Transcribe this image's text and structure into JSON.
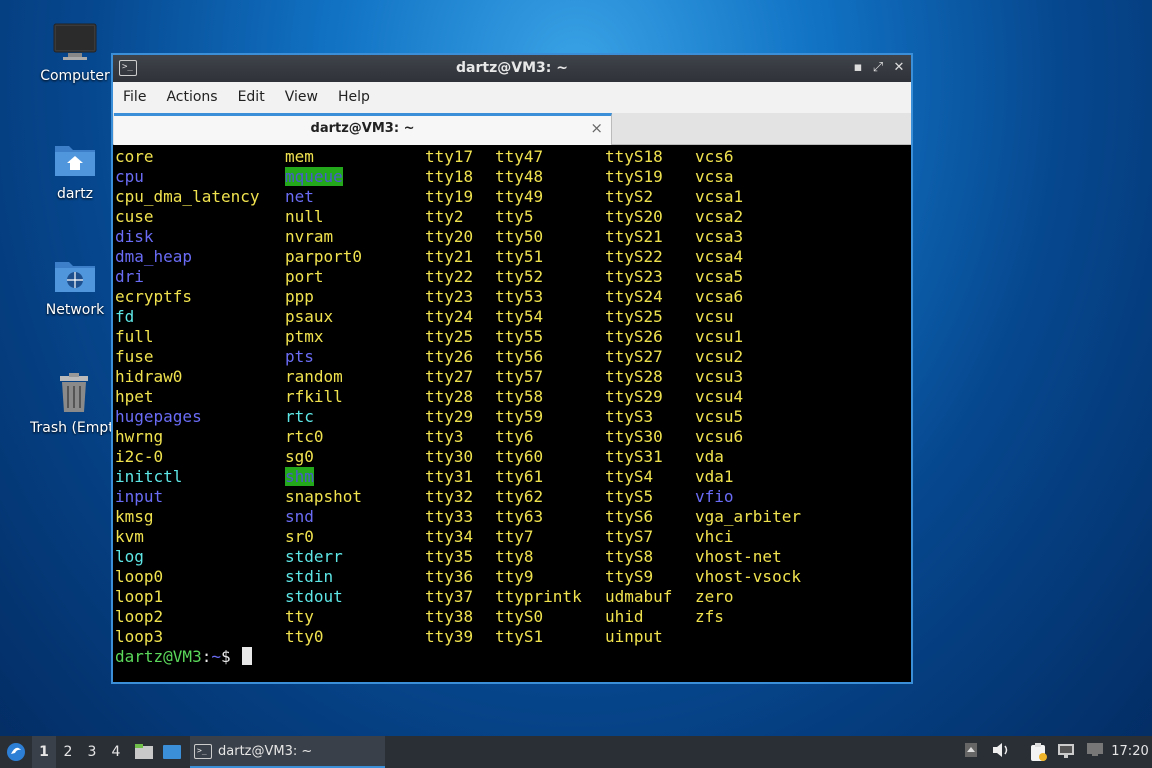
{
  "desktop": {
    "icons": [
      {
        "label": "Computer",
        "icon": "monitor-icon"
      },
      {
        "label": "dartz",
        "icon": "home-folder-icon"
      },
      {
        "label": "Network",
        "icon": "network-folder-icon"
      },
      {
        "label": "Trash (Empty)",
        "icon": "trash-icon"
      }
    ]
  },
  "window": {
    "title": "dartz@VM3: ~",
    "menu": [
      "File",
      "Actions",
      "Edit",
      "View",
      "Help"
    ],
    "tab_label": "dartz@VM3: ~",
    "tab_close": "×"
  },
  "terminal": {
    "columns": [
      [
        {
          "t": "core",
          "c": "yellow"
        },
        {
          "t": "cpu",
          "c": "blue"
        },
        {
          "t": "cpu_dma_latency",
          "c": "yellow"
        },
        {
          "t": "cuse",
          "c": "yellow"
        },
        {
          "t": "disk",
          "c": "blue"
        },
        {
          "t": "dma_heap",
          "c": "blue"
        },
        {
          "t": "dri",
          "c": "blue"
        },
        {
          "t": "ecryptfs",
          "c": "yellow"
        },
        {
          "t": "fd",
          "c": "cyan"
        },
        {
          "t": "full",
          "c": "yellow"
        },
        {
          "t": "fuse",
          "c": "yellow"
        },
        {
          "t": "hidraw0",
          "c": "yellow"
        },
        {
          "t": "hpet",
          "c": "yellow"
        },
        {
          "t": "hugepages",
          "c": "blue"
        },
        {
          "t": "hwrng",
          "c": "yellow"
        },
        {
          "t": "i2c-0",
          "c": "yellow"
        },
        {
          "t": "initctl",
          "c": "cyan"
        },
        {
          "t": "input",
          "c": "blue"
        },
        {
          "t": "kmsg",
          "c": "yellow"
        },
        {
          "t": "kvm",
          "c": "yellow"
        },
        {
          "t": "log",
          "c": "cyan"
        },
        {
          "t": "loop0",
          "c": "yellow"
        },
        {
          "t": "loop1",
          "c": "yellow"
        },
        {
          "t": "loop2",
          "c": "yellow"
        },
        {
          "t": "loop3",
          "c": "yellow"
        }
      ],
      [
        {
          "t": "mem",
          "c": "yellow"
        },
        {
          "t": "mqueue",
          "c": "hl"
        },
        {
          "t": "net",
          "c": "blue"
        },
        {
          "t": "null",
          "c": "yellow"
        },
        {
          "t": "nvram",
          "c": "yellow"
        },
        {
          "t": "parport0",
          "c": "yellow"
        },
        {
          "t": "port",
          "c": "yellow"
        },
        {
          "t": "ppp",
          "c": "yellow"
        },
        {
          "t": "psaux",
          "c": "yellow"
        },
        {
          "t": "ptmx",
          "c": "yellow"
        },
        {
          "t": "pts",
          "c": "blue"
        },
        {
          "t": "random",
          "c": "yellow"
        },
        {
          "t": "rfkill",
          "c": "yellow"
        },
        {
          "t": "rtc",
          "c": "cyan"
        },
        {
          "t": "rtc0",
          "c": "yellow"
        },
        {
          "t": "sg0",
          "c": "yellow"
        },
        {
          "t": "shm",
          "c": "hl"
        },
        {
          "t": "snapshot",
          "c": "yellow"
        },
        {
          "t": "snd",
          "c": "blue"
        },
        {
          "t": "sr0",
          "c": "yellow"
        },
        {
          "t": "stderr",
          "c": "cyan"
        },
        {
          "t": "stdin",
          "c": "cyan"
        },
        {
          "t": "stdout",
          "c": "cyan"
        },
        {
          "t": "tty",
          "c": "yellow"
        },
        {
          "t": "tty0",
          "c": "yellow"
        }
      ],
      [
        {
          "t": "tty17",
          "c": "yellow"
        },
        {
          "t": "tty18",
          "c": "yellow"
        },
        {
          "t": "tty19",
          "c": "yellow"
        },
        {
          "t": "tty2",
          "c": "yellow"
        },
        {
          "t": "tty20",
          "c": "yellow"
        },
        {
          "t": "tty21",
          "c": "yellow"
        },
        {
          "t": "tty22",
          "c": "yellow"
        },
        {
          "t": "tty23",
          "c": "yellow"
        },
        {
          "t": "tty24",
          "c": "yellow"
        },
        {
          "t": "tty25",
          "c": "yellow"
        },
        {
          "t": "tty26",
          "c": "yellow"
        },
        {
          "t": "tty27",
          "c": "yellow"
        },
        {
          "t": "tty28",
          "c": "yellow"
        },
        {
          "t": "tty29",
          "c": "yellow"
        },
        {
          "t": "tty3",
          "c": "yellow"
        },
        {
          "t": "tty30",
          "c": "yellow"
        },
        {
          "t": "tty31",
          "c": "yellow"
        },
        {
          "t": "tty32",
          "c": "yellow"
        },
        {
          "t": "tty33",
          "c": "yellow"
        },
        {
          "t": "tty34",
          "c": "yellow"
        },
        {
          "t": "tty35",
          "c": "yellow"
        },
        {
          "t": "tty36",
          "c": "yellow"
        },
        {
          "t": "tty37",
          "c": "yellow"
        },
        {
          "t": "tty38",
          "c": "yellow"
        },
        {
          "t": "tty39",
          "c": "yellow"
        }
      ],
      [
        {
          "t": "tty47",
          "c": "yellow"
        },
        {
          "t": "tty48",
          "c": "yellow"
        },
        {
          "t": "tty49",
          "c": "yellow"
        },
        {
          "t": "tty5",
          "c": "yellow"
        },
        {
          "t": "tty50",
          "c": "yellow"
        },
        {
          "t": "tty51",
          "c": "yellow"
        },
        {
          "t": "tty52",
          "c": "yellow"
        },
        {
          "t": "tty53",
          "c": "yellow"
        },
        {
          "t": "tty54",
          "c": "yellow"
        },
        {
          "t": "tty55",
          "c": "yellow"
        },
        {
          "t": "tty56",
          "c": "yellow"
        },
        {
          "t": "tty57",
          "c": "yellow"
        },
        {
          "t": "tty58",
          "c": "yellow"
        },
        {
          "t": "tty59",
          "c": "yellow"
        },
        {
          "t": "tty6",
          "c": "yellow"
        },
        {
          "t": "tty60",
          "c": "yellow"
        },
        {
          "t": "tty61",
          "c": "yellow"
        },
        {
          "t": "tty62",
          "c": "yellow"
        },
        {
          "t": "tty63",
          "c": "yellow"
        },
        {
          "t": "tty7",
          "c": "yellow"
        },
        {
          "t": "tty8",
          "c": "yellow"
        },
        {
          "t": "tty9",
          "c": "yellow"
        },
        {
          "t": "ttyprintk",
          "c": "yellow"
        },
        {
          "t": "ttyS0",
          "c": "yellow"
        },
        {
          "t": "ttyS1",
          "c": "yellow"
        }
      ],
      [
        {
          "t": "ttyS18",
          "c": "yellow"
        },
        {
          "t": "ttyS19",
          "c": "yellow"
        },
        {
          "t": "ttyS2",
          "c": "yellow"
        },
        {
          "t": "ttyS20",
          "c": "yellow"
        },
        {
          "t": "ttyS21",
          "c": "yellow"
        },
        {
          "t": "ttyS22",
          "c": "yellow"
        },
        {
          "t": "ttyS23",
          "c": "yellow"
        },
        {
          "t": "ttyS24",
          "c": "yellow"
        },
        {
          "t": "ttyS25",
          "c": "yellow"
        },
        {
          "t": "ttyS26",
          "c": "yellow"
        },
        {
          "t": "ttyS27",
          "c": "yellow"
        },
        {
          "t": "ttyS28",
          "c": "yellow"
        },
        {
          "t": "ttyS29",
          "c": "yellow"
        },
        {
          "t": "ttyS3",
          "c": "yellow"
        },
        {
          "t": "ttyS30",
          "c": "yellow"
        },
        {
          "t": "ttyS31",
          "c": "yellow"
        },
        {
          "t": "ttyS4",
          "c": "yellow"
        },
        {
          "t": "ttyS5",
          "c": "yellow"
        },
        {
          "t": "ttyS6",
          "c": "yellow"
        },
        {
          "t": "ttyS7",
          "c": "yellow"
        },
        {
          "t": "ttyS8",
          "c": "yellow"
        },
        {
          "t": "ttyS9",
          "c": "yellow"
        },
        {
          "t": "udmabuf",
          "c": "yellow"
        },
        {
          "t": "uhid",
          "c": "yellow"
        },
        {
          "t": "uinput",
          "c": "yellow"
        }
      ],
      [
        {
          "t": "vcs6",
          "c": "yellow"
        },
        {
          "t": "vcsa",
          "c": "yellow"
        },
        {
          "t": "vcsa1",
          "c": "yellow"
        },
        {
          "t": "vcsa2",
          "c": "yellow"
        },
        {
          "t": "vcsa3",
          "c": "yellow"
        },
        {
          "t": "vcsa4",
          "c": "yellow"
        },
        {
          "t": "vcsa5",
          "c": "yellow"
        },
        {
          "t": "vcsa6",
          "c": "yellow"
        },
        {
          "t": "vcsu",
          "c": "yellow"
        },
        {
          "t": "vcsu1",
          "c": "yellow"
        },
        {
          "t": "vcsu2",
          "c": "yellow"
        },
        {
          "t": "vcsu3",
          "c": "yellow"
        },
        {
          "t": "vcsu4",
          "c": "yellow"
        },
        {
          "t": "vcsu5",
          "c": "yellow"
        },
        {
          "t": "vcsu6",
          "c": "yellow"
        },
        {
          "t": "vda",
          "c": "yellow"
        },
        {
          "t": "vda1",
          "c": "yellow"
        },
        {
          "t": "vfio",
          "c": "blue"
        },
        {
          "t": "vga_arbiter",
          "c": "yellow"
        },
        {
          "t": "vhci",
          "c": "yellow"
        },
        {
          "t": "vhost-net",
          "c": "yellow"
        },
        {
          "t": "vhost-vsock",
          "c": "yellow"
        },
        {
          "t": "zero",
          "c": "yellow"
        },
        {
          "t": "zfs",
          "c": "yellow"
        }
      ]
    ],
    "prompt": {
      "user": "dartz@VM3",
      "sep": ":",
      "dir": "~",
      "symbol": "$ "
    }
  },
  "taskbar": {
    "workspaces": [
      "1",
      "2",
      "3",
      "4"
    ],
    "active_workspace": "1",
    "task_label": "dartz@VM3: ~",
    "clock": "17:20"
  },
  "colors": {
    "accent": "#3b8fd8",
    "term_yellow": "#f0e24f",
    "term_blue": "#6a6cf6",
    "term_cyan": "#5ee6e6",
    "term_highlight_bg": "#22a81a",
    "prompt_green": "#5bd85b"
  }
}
